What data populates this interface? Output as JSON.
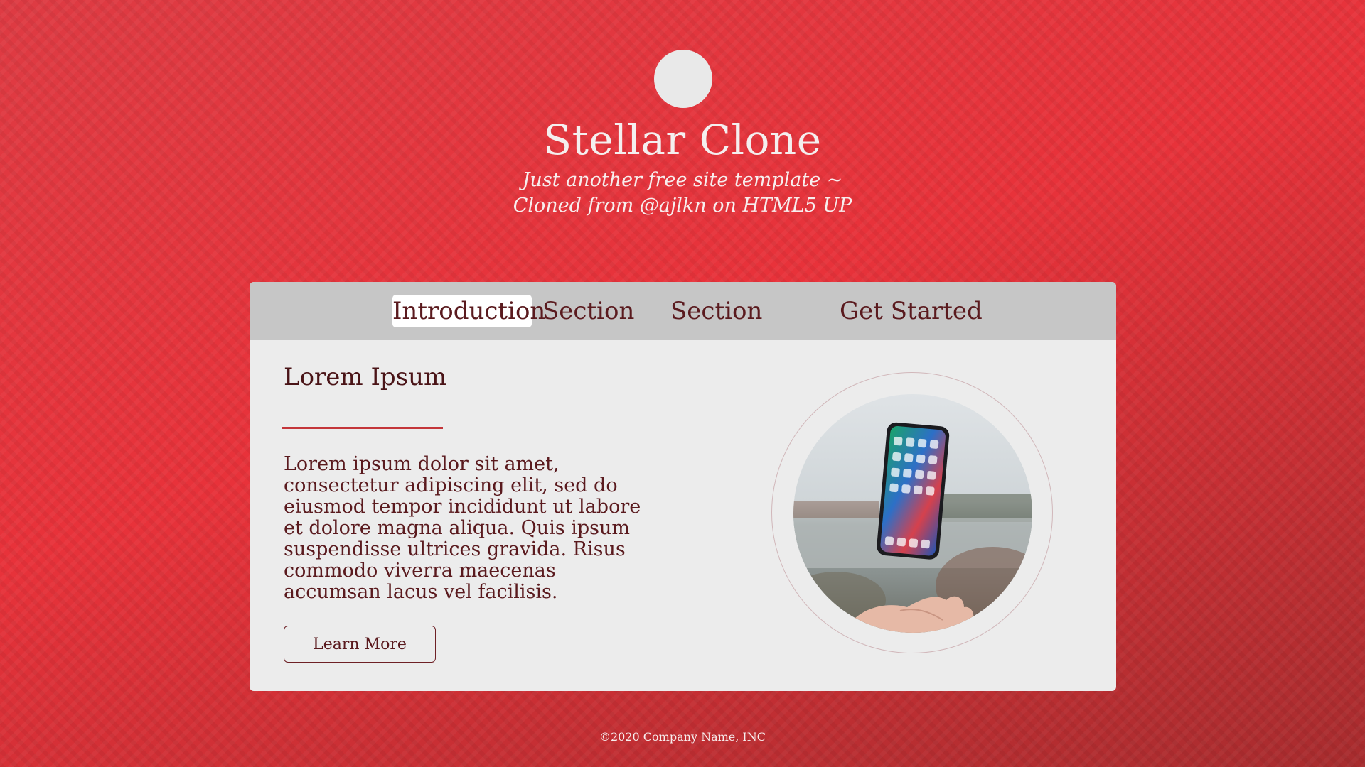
{
  "header": {
    "title": "Stellar Clone",
    "tagline_line1": "Just another free site template ~",
    "tagline_line2": "Cloned from @ajlkn on HTML5 UP"
  },
  "nav": {
    "items": [
      {
        "label": "Introduction",
        "active": true
      },
      {
        "label": "Section",
        "active": false
      },
      {
        "label": "Section",
        "active": false
      },
      {
        "label": "Get Started",
        "active": false
      }
    ]
  },
  "main": {
    "heading": "Lorem Ipsum",
    "body": "Lorem ipsum dolor sit amet, consectetur adipiscing elit, sed do eiusmod tempor incididunt ut labore et dolore magna aliqua. Quis ipsum suspendisse ultrices gravida. Risus commodo viverra maecenas accumsan lacus vel facilisis.",
    "button_label": "Learn More",
    "image": "phone-floating-over-hand-lake-photo"
  },
  "footer": {
    "copyright": "©2020 Company Name, INC"
  },
  "colors": {
    "background_red": "#e8323a",
    "card_bg": "#ececec",
    "nav_bg": "#c6c6c6",
    "text_dark_red": "#5a1a1e",
    "accent_line": "#c4363a"
  }
}
